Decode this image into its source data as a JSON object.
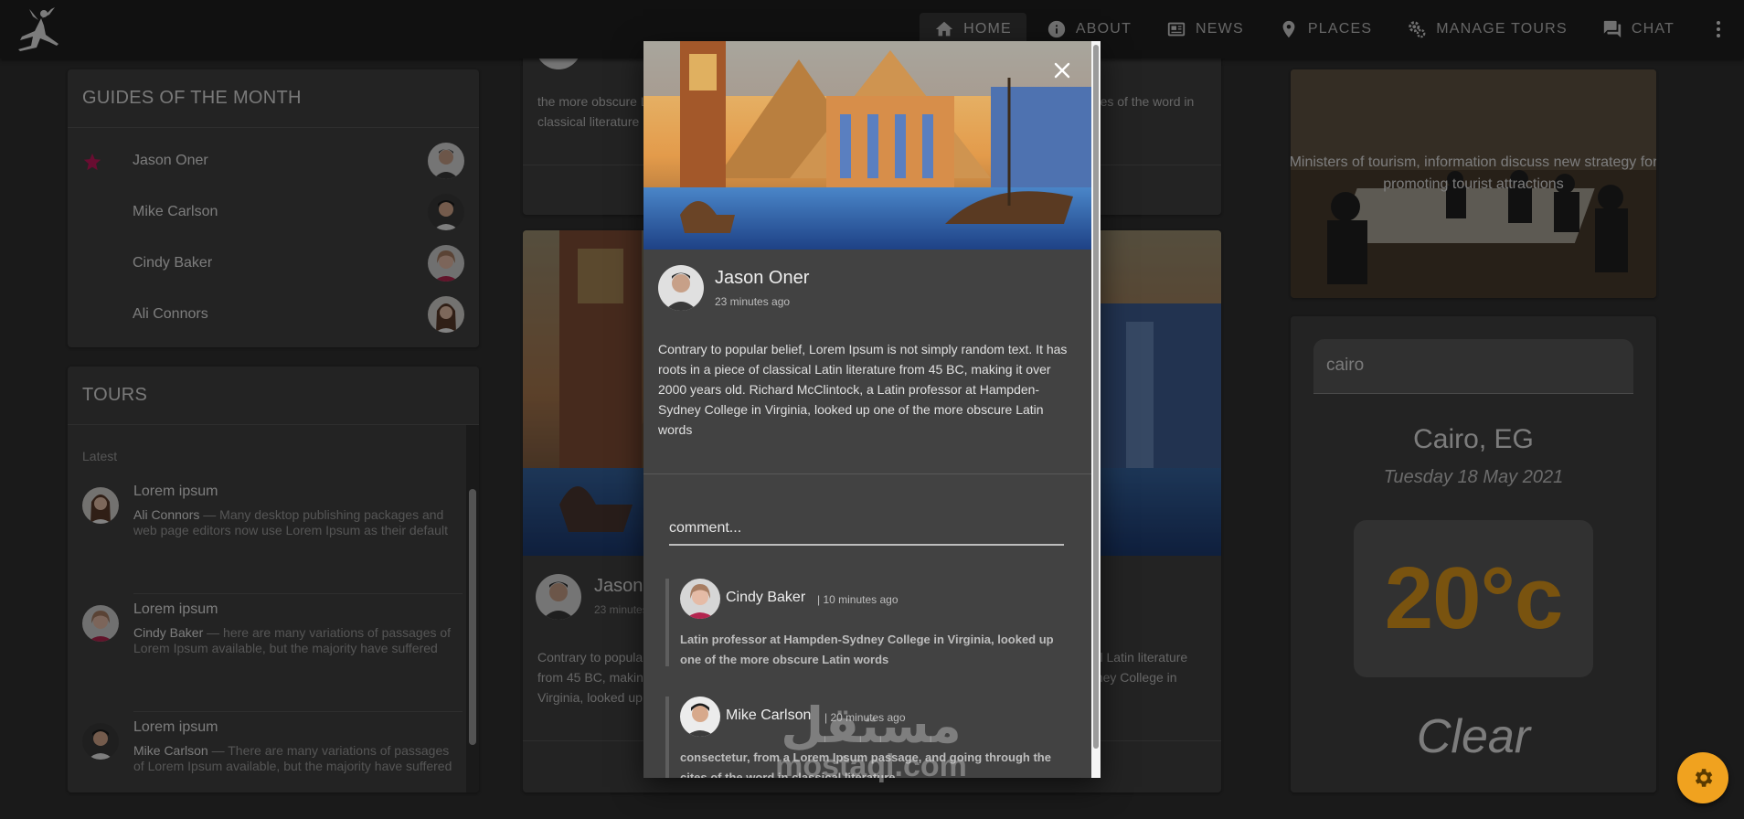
{
  "nav": {
    "items": [
      {
        "label": "HOME",
        "icon": "home-icon",
        "active": true
      },
      {
        "label": "ABOUT",
        "icon": "info-icon"
      },
      {
        "label": "NEWS",
        "icon": "newspaper-icon"
      },
      {
        "label": "PLACES",
        "icon": "location-pin-icon"
      },
      {
        "label": "MANAGE TOURS",
        "icon": "gears-icon"
      },
      {
        "label": "CHAT",
        "icon": "forum-icon"
      }
    ]
  },
  "guides": {
    "title": "GUIDES OF THE MONTH",
    "items": [
      {
        "name": "Jason Oner",
        "starred": true
      },
      {
        "name": "Mike Carlson"
      },
      {
        "name": "Cindy Baker"
      },
      {
        "name": "Ali Connors"
      }
    ]
  },
  "tours": {
    "title": "TOURS",
    "subheader": "Latest",
    "items": [
      {
        "title": "Lorem ipsum",
        "author": "Ali Connors",
        "body": " — Many desktop publishing packages and web page editors now use Lorem Ipsum as their default model text"
      },
      {
        "title": "Lorem ipsum",
        "author": "Cindy Baker",
        "body": " — here are many variations of passages of Lorem Ipsum available, but the majority have suffered alteration"
      },
      {
        "title": "Lorem ipsum",
        "author": "Mike Carlson",
        "body": " — There are many variations of passages of Lorem Ipsum available, but the majority have suffered alteration"
      }
    ]
  },
  "posts": {
    "first_text": "the more obscure Latin words, consectetur, from a Lorem Ipsum passage, and going through the cites of the word in classical literature",
    "second_author": "Jason Oner",
    "second_time": "23 minutes ago",
    "second_text": "Contrary to popular belief, Lorem Ipsum is not simply random text. It has roots in a piece of classical Latin literature from 45 BC, making it over 2000 years old. Richard McClintock, a Latin professor at Hampden-Sydney College in Virginia, looked up"
  },
  "news": {
    "caption": "Ministers of tourism, information discuss new strategy for promoting tourist attractions"
  },
  "weather": {
    "search_value": "cairo",
    "city": "Cairo, EG",
    "date": "Tuesday 18 May 2021",
    "temp": "20°c",
    "condition": "Clear",
    "temp_color": "#e09a1c"
  },
  "dialog": {
    "author": "Jason Oner",
    "time": "23 minutes ago",
    "text": "Contrary to popular belief, Lorem Ipsum is not simply random text. It has roots in a piece of classical Latin literature from 45 BC, making it over 2000 years old. Richard McClintock, a Latin professor at Hampden-Sydney College in Virginia, looked up one of the more obscure Latin words",
    "comment_placeholder": "comment...",
    "comments": [
      {
        "name": "Cindy Baker",
        "time": "| 10 minutes ago",
        "text": "Latin professor at Hampden-Sydney College in Virginia, looked up one of the more obscure Latin words"
      },
      {
        "name": "Mike Carlson",
        "time": "| 20 minutes ago",
        "text": "consectetur, from a Lorem Ipsum passage, and going through the cites of the word in classical literature"
      }
    ]
  },
  "watermark": {
    "arabic": "مستقل",
    "latin": "mostaql.com"
  },
  "colors": {
    "accent": "#f0a21f",
    "star": "#c2185b",
    "background": "#303030",
    "card": "#424242"
  }
}
